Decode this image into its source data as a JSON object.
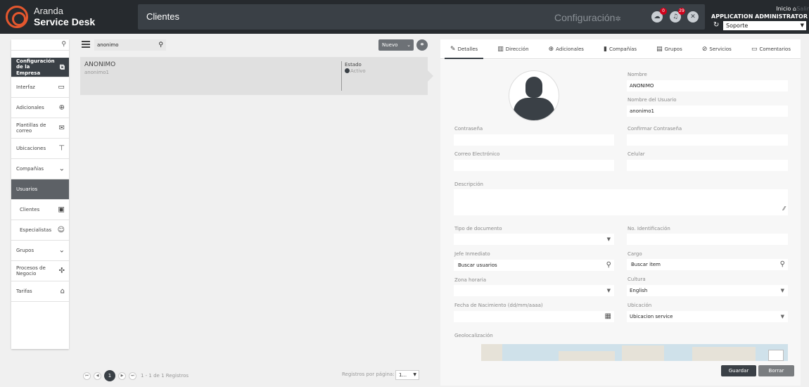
{
  "header": {
    "logo_top": "Aranda",
    "logo_bottom": "Service Desk",
    "page_title": "Clientes",
    "config_label": "Configuración",
    "notif_download_count": "0",
    "notif_bell_count": "29",
    "home_label": "Inicio",
    "logout_label": "Salir",
    "user_role": "APPLICATION ADMINISTRATOR",
    "project_select": "Soporte"
  },
  "sidebar": {
    "items": [
      {
        "label": "Configuración de la Empresa",
        "icon": "copy-icon"
      },
      {
        "label": "Interfaz",
        "icon": "monitor-icon"
      },
      {
        "label": "Adicionales",
        "icon": "plus-circle-icon"
      },
      {
        "label": "Plantillas de correo",
        "icon": "mail-icon"
      },
      {
        "label": "Ubicaciones",
        "icon": "signpost-icon"
      },
      {
        "label": "Compañías",
        "icon": "chevron-down-icon"
      },
      {
        "label": "Usuarios",
        "icon": ""
      },
      {
        "label": "Clientes",
        "icon": "contact-card-icon"
      },
      {
        "label": "Especialistas",
        "icon": "specialist-icon"
      },
      {
        "label": "Grupos",
        "icon": "chevron-down-icon"
      },
      {
        "label": "Procesos de Negocio",
        "icon": "process-icon"
      },
      {
        "label": "Tarifas",
        "icon": "bank-icon"
      }
    ]
  },
  "list": {
    "search_value": "anonimo",
    "new_button": "Nuevo",
    "record": {
      "name": "ANONIMO",
      "username": "anonimo1",
      "state_label": "Estado",
      "state_value": "Activo"
    },
    "pager": {
      "current_page": "1",
      "info": "1 - 1 de 1 Registros",
      "per_page_label": "Registros por página:",
      "per_page_value": "1..."
    }
  },
  "detail": {
    "tabs": [
      {
        "label": "Detalles",
        "icon": "edit-icon"
      },
      {
        "label": "Dirección",
        "icon": "building-icon"
      },
      {
        "label": "Adicionales",
        "icon": "plus-circle-icon"
      },
      {
        "label": "Compañías",
        "icon": "company-icon"
      },
      {
        "label": "Grupos",
        "icon": "group-icon"
      },
      {
        "label": "Servicios",
        "icon": "services-icon"
      },
      {
        "label": "Comentarios",
        "icon": "comment-icon"
      }
    ],
    "fields": {
      "nombre_label": "Nombre",
      "nombre_value": "ANONIMO",
      "usuario_label": "Nombre del Usuario",
      "usuario_value": "anonimo1",
      "contrasena_label": "Contraseña",
      "confirmar_label": "Confirmar Contraseña",
      "correo_label": "Correo Electrónico",
      "celular_label": "Celular",
      "descripcion_label": "Descripción",
      "tipo_doc_label": "Tipo de documento",
      "identificacion_label": "No. Identificación",
      "jefe_label": "Jefe Inmediato",
      "jefe_placeholder": "Buscar usuarios",
      "cargo_label": "Cargo",
      "cargo_placeholder": "Buscar item",
      "zona_label": "Zona horaria",
      "cultura_label": "Cultura",
      "cultura_value": "English",
      "fecha_label": "Fecha de Nacimiento (dd/mm/aaaa)",
      "ubicacion_label": "Ubicación",
      "ubicacion_value": "Ubicacion service",
      "geo_label": "Geolocalización"
    },
    "save_button": "Guardar",
    "delete_button": "Borrar"
  }
}
